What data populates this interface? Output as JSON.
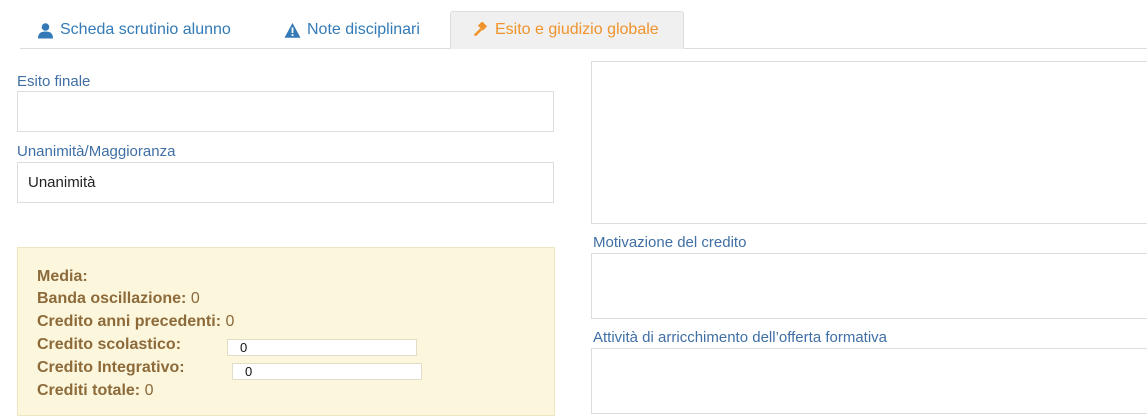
{
  "tabs": {
    "student_sheet": {
      "label": "Scheda scrutinio alunno",
      "icon": "user-icon"
    },
    "disciplinary_notes": {
      "label": "Note disciplinari",
      "icon": "warning-icon"
    },
    "outcome": {
      "label": "Esito e giudizio globale",
      "icon": "gavel-icon",
      "active": true
    }
  },
  "colors": {
    "link": "#337ab7",
    "active_tab": "#f0932b",
    "label": "#3f6fa5",
    "box_bg": "#fbf6dc",
    "box_text": "#8d6a3a"
  },
  "form": {
    "esito_finale": {
      "label": "Esito finale",
      "value": ""
    },
    "unanimita": {
      "label": "Unanimità/Maggioranza",
      "value": "Unanimità"
    }
  },
  "media_box": {
    "media": {
      "label": "Media:",
      "value": ""
    },
    "banda": {
      "label": "Banda oscillazione:",
      "value": "0"
    },
    "credito_prec": {
      "label": "Credito anni precedenti:",
      "value": "0"
    },
    "credito_scol": {
      "label": "Credito scolastico:",
      "value": "0"
    },
    "credito_integ": {
      "label": "Credito Integrativo:",
      "value": "0"
    },
    "crediti_tot": {
      "label": "Crediti totale:",
      "value": "0"
    }
  },
  "right": {
    "motivazione": {
      "label": "Motivazione del credito",
      "value": ""
    },
    "attivita": {
      "label": "Attività di arricchimento dell’offerta formativa",
      "value": ""
    }
  }
}
